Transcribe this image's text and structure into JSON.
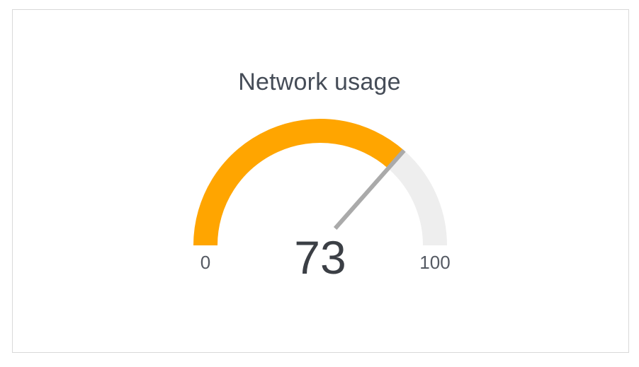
{
  "chart_data": {
    "type": "gauge",
    "title": "Network usage",
    "value": 73,
    "min": 0,
    "max": 100,
    "min_label": "0",
    "max_label": "100",
    "value_label": "73",
    "colors": {
      "fill": "#FFA500",
      "track": "#EEEEEE",
      "needle": "#AAAAAA"
    }
  }
}
